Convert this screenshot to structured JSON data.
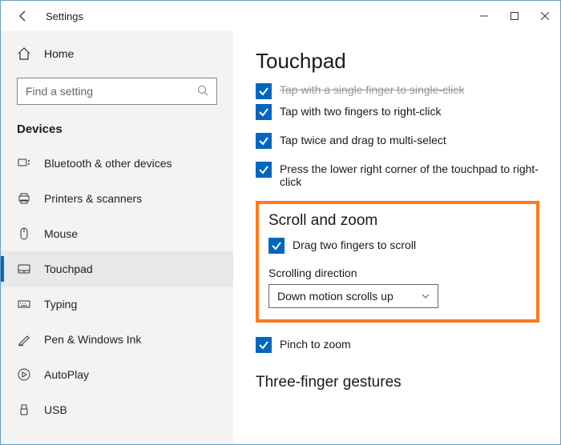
{
  "titlebar": {
    "title": "Settings"
  },
  "home_label": "Home",
  "search": {
    "placeholder": "Find a setting"
  },
  "group_header": "Devices",
  "nav": [
    {
      "label": "Bluetooth & other devices"
    },
    {
      "label": "Printers & scanners"
    },
    {
      "label": "Mouse"
    },
    {
      "label": "Touchpad"
    },
    {
      "label": "Typing"
    },
    {
      "label": "Pen & Windows Ink"
    },
    {
      "label": "AutoPlay"
    },
    {
      "label": "USB"
    }
  ],
  "page_title": "Touchpad",
  "clipped_row": "Tap with a single finger to single-click",
  "checks": {
    "two_finger_right": "Tap with two fingers to right-click",
    "tap_twice_drag": "Tap twice and drag to multi-select",
    "corner_right": "Press the lower right corner of the touchpad to right-click",
    "drag_scroll": "Drag two fingers to scroll",
    "pinch_zoom": "Pinch to zoom"
  },
  "scroll_zoom_title": "Scroll and zoom",
  "direction_label": "Scrolling direction",
  "direction_value": "Down motion scrolls up",
  "three_finger_title": "Three-finger gestures"
}
